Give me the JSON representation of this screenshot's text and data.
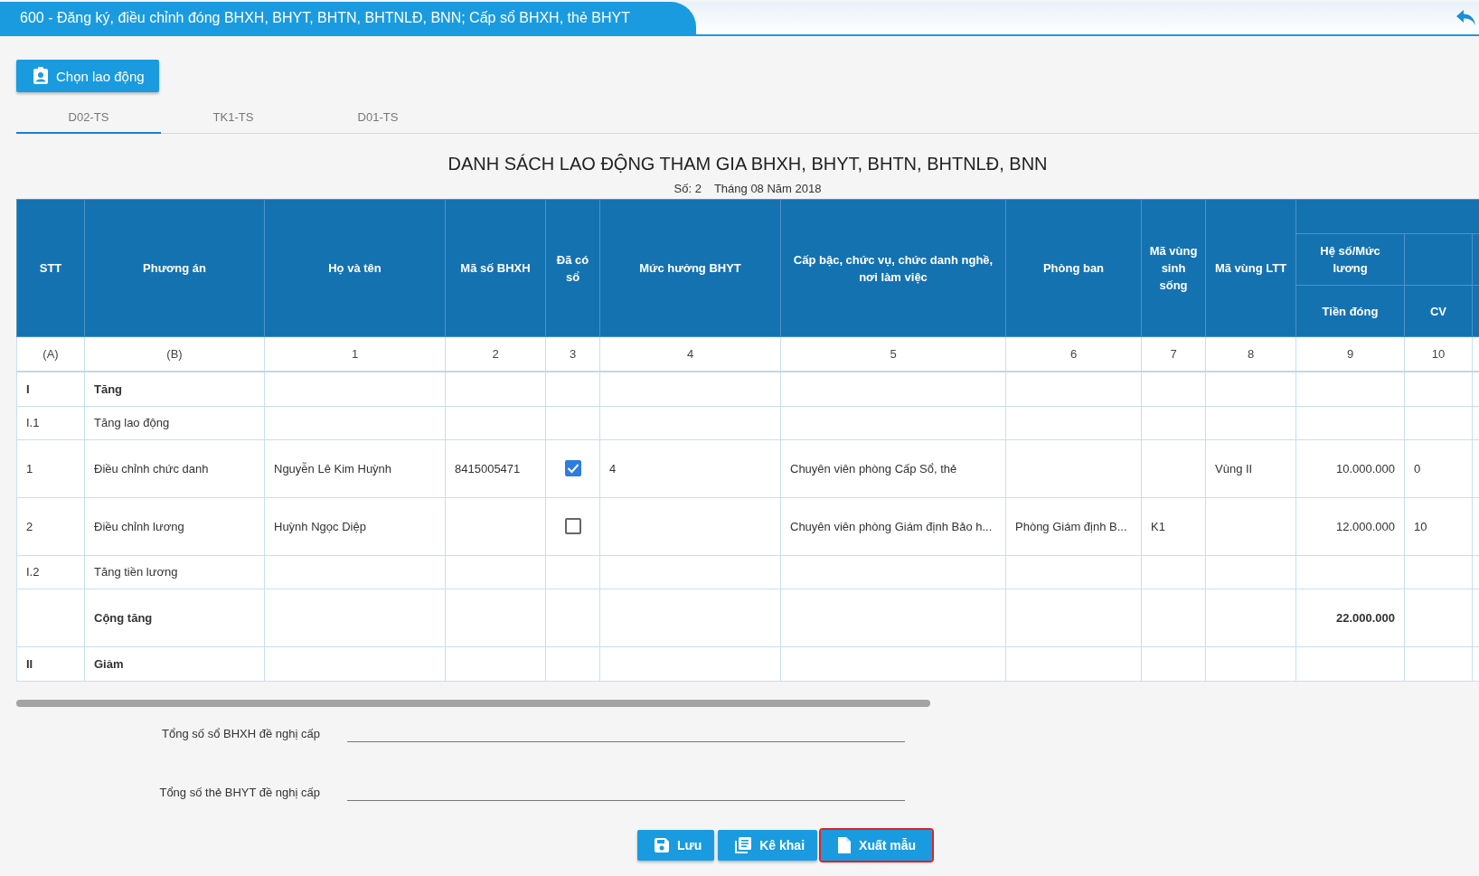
{
  "window": {
    "title": "600 - Đăng ký, điều chỉnh đóng BHXH, BHYT, BHTN, BHTNLĐ, BNN; Cấp sổ BHXH, thẻ BHYT"
  },
  "choose_button": {
    "label": "Chọn lao động"
  },
  "tabs": [
    {
      "label": "D02-TS",
      "selected": true
    },
    {
      "label": "TK1-TS",
      "selected": false
    },
    {
      "label": "D01-TS",
      "selected": false
    }
  ],
  "report": {
    "title": "DANH SÁCH LAO ĐỘNG THAM GIA BHXH, BHYT, BHTN, BHTNLĐ, BNN",
    "number": "Số: 2",
    "period": "Tháng 08 Năm 2018"
  },
  "table": {
    "columns": [
      {
        "label": "STT",
        "number": "(A)"
      },
      {
        "label": "Phương án",
        "number": "(B)"
      },
      {
        "label": "Họ và tên",
        "number": "1"
      },
      {
        "label": "Mã số BHXH",
        "number": "2"
      },
      {
        "label": "Đã có sổ",
        "number": "3"
      },
      {
        "label": "Mức hưởng BHYT",
        "number": "4"
      },
      {
        "label": "Cấp bậc, chức vụ, chức danh nghề, nơi làm việc",
        "number": "5"
      },
      {
        "label": "Phòng ban",
        "number": "6"
      },
      {
        "label": "Mã vùng sinh sống",
        "number": "7"
      },
      {
        "label": "Mã vùng LTT",
        "number": "8"
      },
      {
        "group": "Hệ số/Mức lương",
        "label": "Tiền đóng",
        "number": "9"
      },
      {
        "label": "CV",
        "number": "10"
      }
    ],
    "rows": [
      {
        "kind": "section",
        "stt": "I",
        "phuong_an": "Tăng"
      },
      {
        "kind": "subsection",
        "stt": "I.1",
        "phuong_an": "Tăng lao động"
      },
      {
        "kind": "employee",
        "stt": "1",
        "phuong_an": "Điều chỉnh chức danh",
        "ho_ten": "Nguyễn Lê Kim Huỳnh",
        "ma_so": "8415005471",
        "checked": true,
        "muc_huong": "4",
        "cap_bac": "Chuyên viên phòng Cấp Sổ, thẻ",
        "phong_ban": "",
        "vung_sinh_song": "",
        "vung_ltt": "Vùng II",
        "tien_dong": "10.000.000",
        "cv": "0"
      },
      {
        "kind": "employee",
        "stt": "2",
        "phuong_an": "Điều chỉnh lương",
        "ho_ten": "Huỳnh Ngọc Diệp",
        "ma_so": "",
        "checked": false,
        "muc_huong": "",
        "cap_bac": "Chuyên viên phòng Giám định Bảo h...",
        "phong_ban": "Phòng Giám định B...",
        "vung_sinh_song": "K1",
        "vung_ltt": "",
        "tien_dong": "12.000.000",
        "cv": "10"
      },
      {
        "kind": "subsection",
        "stt": "I.2",
        "phuong_an": "Tăng tiền lương"
      },
      {
        "kind": "total",
        "phuong_an": "Cộng tăng",
        "tien_dong": "22.000.000"
      },
      {
        "kind": "section",
        "stt": "II",
        "phuong_an": "Giảm"
      }
    ]
  },
  "summary_fields": [
    {
      "label": "Tổng số sổ BHXH đề nghị cấp"
    },
    {
      "label": "Tổng số thẻ BHYT đề nghị cấp"
    }
  ],
  "actions": [
    {
      "kind": "save",
      "label": "Lưu",
      "highlighted": false
    },
    {
      "kind": "declare",
      "label": "Kê khai",
      "highlighted": false
    },
    {
      "kind": "export",
      "label": "Xuất mẫu",
      "highlighted": true
    }
  ]
}
